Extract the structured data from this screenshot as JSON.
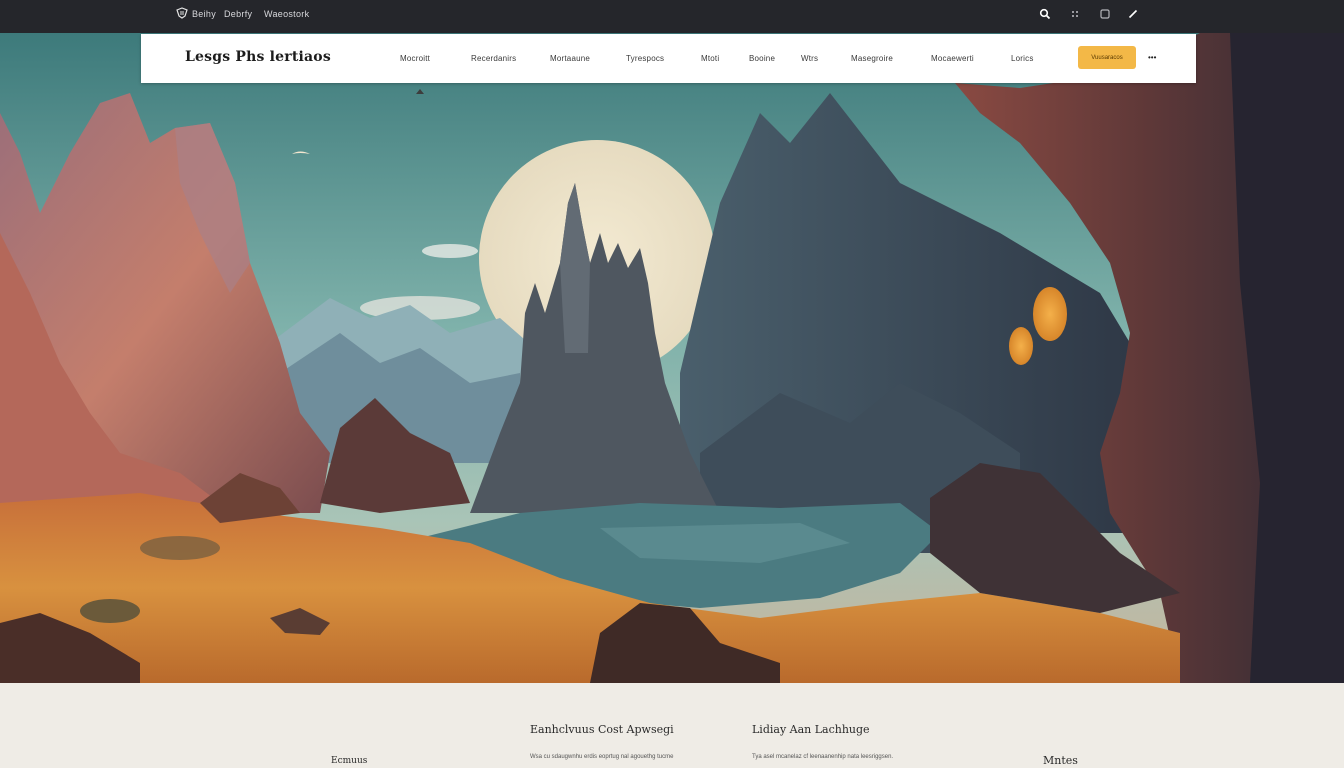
{
  "topbar": {
    "links": [
      "Beihy",
      "Debrfy",
      "Waeostork"
    ],
    "icons": [
      "search-icon",
      "grid-icon",
      "window-icon",
      "pen-icon"
    ],
    "background": "#25262b"
  },
  "nav": {
    "brand": "Lesgs Phs lertiaos",
    "items": [
      "Mocroitt",
      "Recerdanirs",
      "Mortaaune",
      "Tyrespocs",
      "Mtoti",
      "Booine",
      "Wtrs",
      "Masegroire",
      "Mocaewerti",
      "Lorics"
    ],
    "cta_label": "Vuusaracos",
    "lang_label": "•••",
    "accent": "#f3b847"
  },
  "hero": {
    "sky_top": "#3e7f80",
    "sun": "#f1e5c8",
    "ground": "#d88a3a"
  },
  "footer": {
    "col1_heading": "Eanhclvuus Cost Apwsegi",
    "col1_text": "Wsa cu sdaugwnhu erdis eoprtug nal agouethg tucme",
    "col2_heading": "Lidiay Aan Lachhuge",
    "col2_text": "Tya asel mcanelaz cf leenaanenhip nata leesriggsen.",
    "left_label": "Ecmuus",
    "right_label": "Mntes"
  }
}
